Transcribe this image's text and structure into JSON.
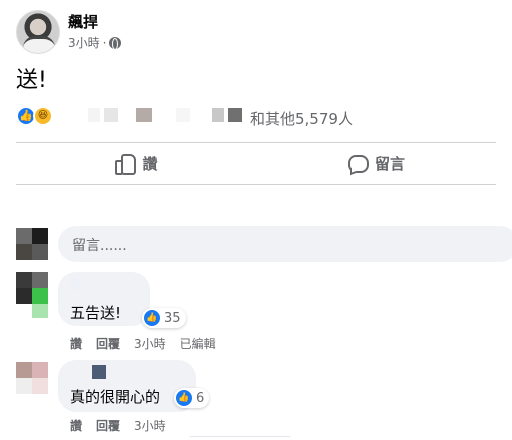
{
  "post": {
    "author": "飆捍",
    "meta": {
      "time": "3小時",
      "separator": "·",
      "audience_icon": "globe-icon"
    },
    "text": "送!",
    "reactions": {
      "icons": [
        "like-icon",
        "haha-icon"
      ],
      "summary": "和其他5,579人"
    },
    "actions": {
      "like": "讚",
      "comment": "留言"
    }
  },
  "composer": {
    "placeholder": "留言......"
  },
  "comments": [
    {
      "text": "五告送!",
      "likes": "35",
      "actions": {
        "like": "讚",
        "reply": "回覆",
        "time": "3小時",
        "edited": "已編輯"
      }
    },
    {
      "text": "真的很開心的",
      "likes": "6",
      "actions": {
        "like": "讚",
        "reply": "回覆",
        "time": "3小時"
      }
    }
  ],
  "colors": {
    "accent": "#1877f2",
    "secondary_text": "#65676b",
    "bubble_bg": "#f0f2f5"
  }
}
